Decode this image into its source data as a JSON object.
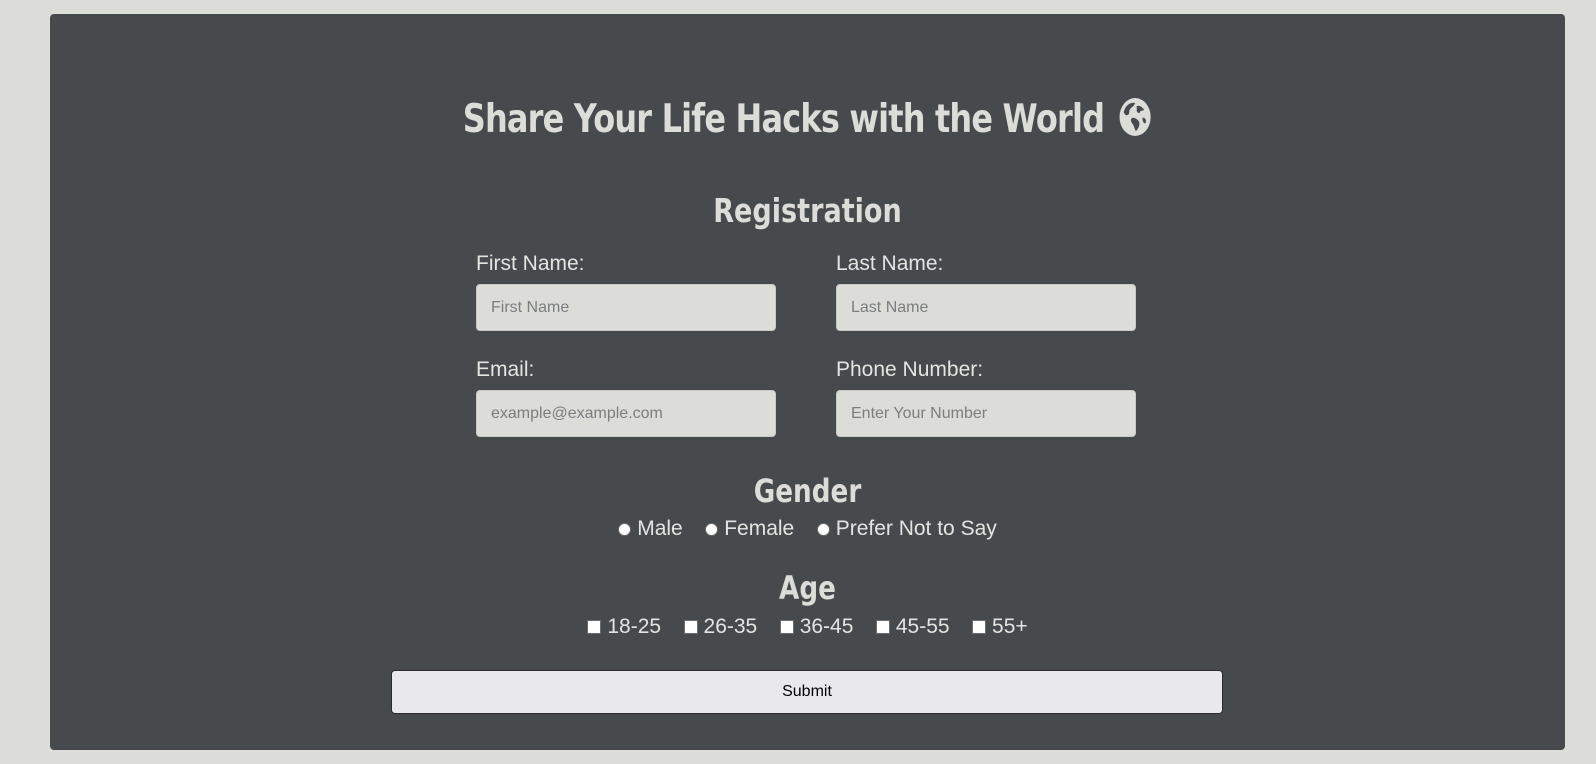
{
  "header": {
    "title": "Share Your Life Hacks with the World",
    "title_icon": "globe-icon"
  },
  "form": {
    "section_title": "Registration",
    "first_name": {
      "label": "First Name:",
      "placeholder": "First Name",
      "value": ""
    },
    "last_name": {
      "label": "Last Name:",
      "placeholder": "Last Name",
      "value": ""
    },
    "email": {
      "label": "Email:",
      "placeholder": "example@example.com",
      "value": ""
    },
    "phone": {
      "label": "Phone Number:",
      "placeholder": "Enter Your Number",
      "value": ""
    },
    "gender": {
      "title": "Gender",
      "options": [
        "Male",
        "Female",
        "Prefer Not to Say"
      ],
      "selected": null
    },
    "age": {
      "title": "Age",
      "options": [
        "18-25",
        "26-35",
        "36-45",
        "45-55",
        "55+"
      ],
      "checked": []
    },
    "submit_label": "Submit"
  },
  "colors": {
    "page_background": "#dcddd8",
    "card_background": "#464a4d",
    "text": "#dcdcd8",
    "input_background": "#dcddd8",
    "button_background": "#e9e9ed"
  }
}
